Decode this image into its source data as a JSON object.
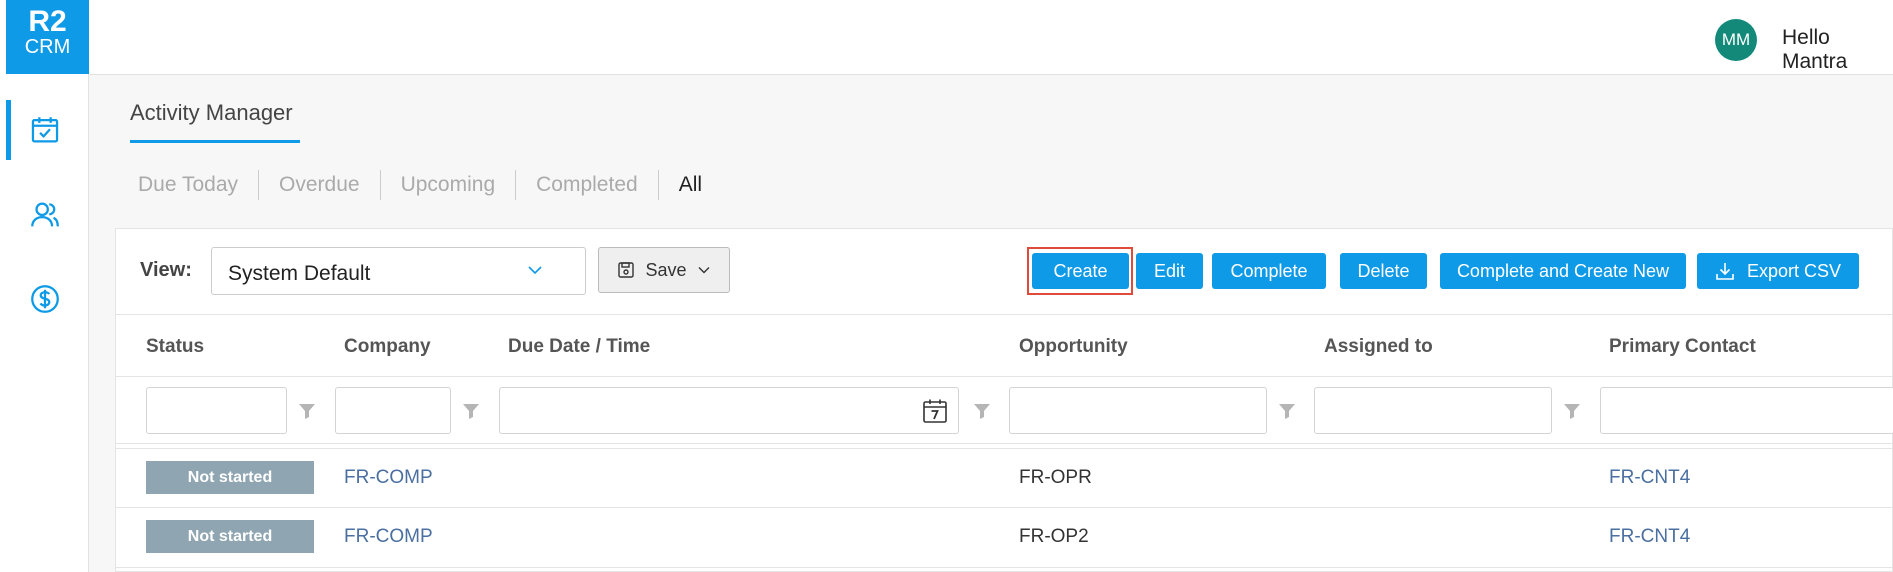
{
  "brand": {
    "line1": "R2",
    "line2": "CRM",
    "color": "#0f9ae8"
  },
  "sidebar": {
    "items": [
      {
        "name": "activities",
        "icon": "calendar-check-icon",
        "active": true
      },
      {
        "name": "contacts",
        "icon": "users-icon",
        "active": false
      },
      {
        "name": "deals",
        "icon": "dollar-circle-icon",
        "active": false
      }
    ]
  },
  "header": {
    "avatar_initials": "MM",
    "greeting": "Hello Mantra",
    "logout_icon": "logout-icon"
  },
  "page": {
    "title": "Activity Manager"
  },
  "tabs": [
    {
      "label": "Due Today",
      "active": false
    },
    {
      "label": "Overdue",
      "active": false
    },
    {
      "label": "Upcoming",
      "active": false
    },
    {
      "label": "Completed",
      "active": false
    },
    {
      "label": "All",
      "active": true
    }
  ],
  "toolbar": {
    "view_label": "View:",
    "view_value": "System Default",
    "save_label": "Save",
    "create_label": "Create",
    "edit_label": "Edit",
    "complete_label": "Complete",
    "delete_label": "Delete",
    "complete_create_label": "Complete and Create New",
    "export_label": "Export CSV"
  },
  "table": {
    "columns": [
      "Status",
      "Company",
      "Due Date / Time",
      "Opportunity",
      "Assigned to",
      "Primary Contact"
    ],
    "rows": [
      {
        "status": "Not started",
        "company": "FR-COMP",
        "due": "",
        "opportunity": "FR-OPR",
        "assigned": "",
        "contact": "FR-CNT4"
      },
      {
        "status": "Not started",
        "company": "FR-COMP",
        "due": "",
        "opportunity": "FR-OP2",
        "assigned": "",
        "contact": "FR-CNT4"
      }
    ]
  },
  "colors": {
    "accent": "#0f9ae8",
    "badge": "#8fa6b2",
    "avatar": "#13897a",
    "highlight": "#e04a3b",
    "link": "#4a6fa0"
  }
}
